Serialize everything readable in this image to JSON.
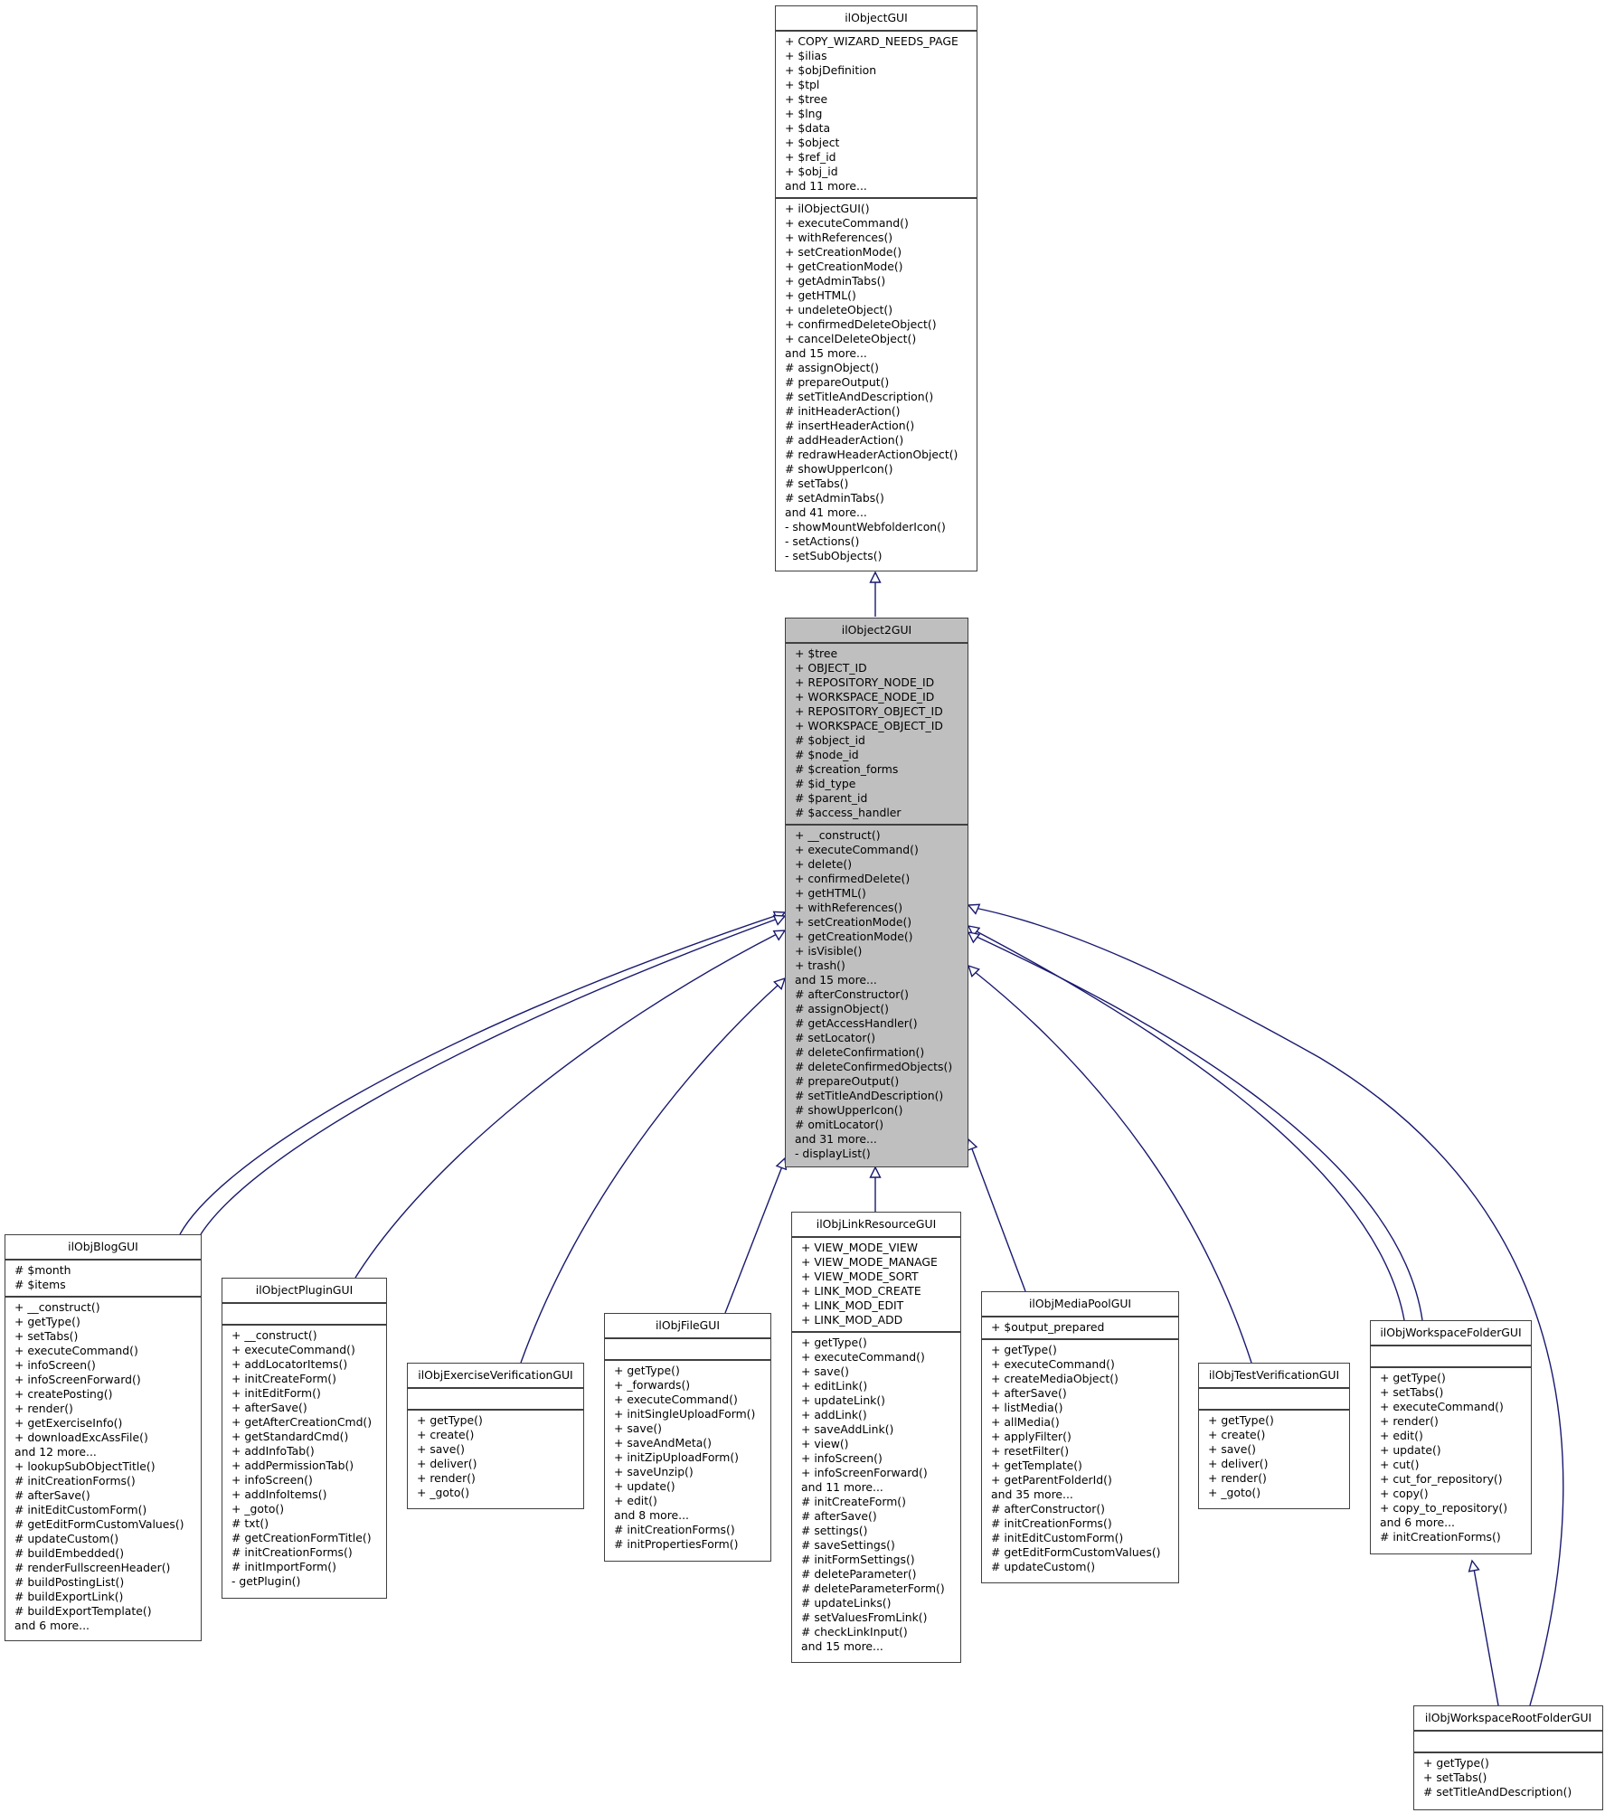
{
  "diagram": {
    "type": "uml-class-inheritance",
    "edge_color": "#191970",
    "focus_fill": "#bfbfbf"
  },
  "classes": {
    "ilObjectGUI": {
      "name": "ilObjectGUI",
      "attributes": [
        "+ COPY_WIZARD_NEEDS_PAGE",
        "+ $ilias",
        "+ $objDefinition",
        "+ $tpl",
        "+ $tree",
        "+ $lng",
        "+ $data",
        "+ $object",
        "+ $ref_id",
        "+ $obj_id",
        "and 11 more..."
      ],
      "methods": [
        "+ ilObjectGUI()",
        "+ executeCommand()",
        "+ withReferences()",
        "+ setCreationMode()",
        "+ getCreationMode()",
        "+ getAdminTabs()",
        "+ getHTML()",
        "+ undeleteObject()",
        "+ confirmedDeleteObject()",
        "+ cancelDeleteObject()",
        "and 15 more...",
        "# assignObject()",
        "# prepareOutput()",
        "# setTitleAndDescription()",
        "# initHeaderAction()",
        "# insertHeaderAction()",
        "# addHeaderAction()",
        "# redrawHeaderActionObject()",
        "# showUpperIcon()",
        "# setTabs()",
        "# setAdminTabs()",
        "and 41 more...",
        "- showMountWebfolderIcon()",
        "- setActions()",
        "- setSubObjects()"
      ]
    },
    "ilObject2GUI": {
      "name": "ilObject2GUI",
      "attributes": [
        "+ $tree",
        "+ OBJECT_ID",
        "+ REPOSITORY_NODE_ID",
        "+ WORKSPACE_NODE_ID",
        "+ REPOSITORY_OBJECT_ID",
        "+ WORKSPACE_OBJECT_ID",
        "# $object_id",
        "# $node_id",
        "# $creation_forms",
        "# $id_type",
        "# $parent_id",
        "# $access_handler"
      ],
      "methods": [
        "+ __construct()",
        "+ executeCommand()",
        "+ delete()",
        "+ confirmedDelete()",
        "+ getHTML()",
        "+ withReferences()",
        "+ setCreationMode()",
        "+ getCreationMode()",
        "+ isVisible()",
        "+ trash()",
        "and 15 more...",
        "# afterConstructor()",
        "# assignObject()",
        "# getAccessHandler()",
        "# setLocator()",
        "# deleteConfirmation()",
        "# deleteConfirmedObjects()",
        "# prepareOutput()",
        "# setTitleAndDescription()",
        "# showUpperIcon()",
        "# omitLocator()",
        "and 31 more...",
        "- displayList()"
      ]
    },
    "ilObjBlogGUI": {
      "name": "ilObjBlogGUI",
      "attributes": [
        "# $month",
        "# $items"
      ],
      "methods": [
        "+ __construct()",
        "+ getType()",
        "+ setTabs()",
        "+ executeCommand()",
        "+ infoScreen()",
        "+ infoScreenForward()",
        "+ createPosting()",
        "+ render()",
        "+ getExerciseInfo()",
        "+ downloadExcAssFile()",
        "and 12 more...",
        "+ lookupSubObjectTitle()",
        "# initCreationForms()",
        "# afterSave()",
        "# initEditCustomForm()",
        "# getEditFormCustomValues()",
        "# updateCustom()",
        "# buildEmbedded()",
        "# renderFullscreenHeader()",
        "# buildPostingList()",
        "# buildExportLink()",
        "# buildExportTemplate()",
        "and 6 more..."
      ]
    },
    "ilObjectPluginGUI": {
      "name": "ilObjectPluginGUI",
      "attributes": [],
      "methods": [
        "+ __construct()",
        "+ executeCommand()",
        "+ addLocatorItems()",
        "+ initCreateForm()",
        "+ initEditForm()",
        "+ afterSave()",
        "+ getAfterCreationCmd()",
        "+ getStandardCmd()",
        "+ addInfoTab()",
        "+ addPermissionTab()",
        "+ infoScreen()",
        "+ addInfoItems()",
        "+ _goto()",
        "# txt()",
        "# getCreationFormTitle()",
        "# initCreationForms()",
        "# initImportForm()",
        "- getPlugin()"
      ]
    },
    "ilObjExerciseVerificationGUI": {
      "name": "ilObjExerciseVerificationGUI",
      "attributes": [],
      "methods": [
        "+ getType()",
        "+ create()",
        "+ save()",
        "+ deliver()",
        "+ render()",
        "+ _goto()"
      ]
    },
    "ilObjFileGUI": {
      "name": "ilObjFileGUI",
      "attributes": [],
      "methods": [
        "+ getType()",
        "+ _forwards()",
        "+ executeCommand()",
        "+ initSingleUploadForm()",
        "+ save()",
        "+ saveAndMeta()",
        "+ initZipUploadForm()",
        "+ saveUnzip()",
        "+ update()",
        "+ edit()",
        "and 8 more...",
        "# initCreationForms()",
        "# initPropertiesForm()"
      ]
    },
    "ilObjLinkResourceGUI": {
      "name": "ilObjLinkResourceGUI",
      "attributes": [
        "+ VIEW_MODE_VIEW",
        "+ VIEW_MODE_MANAGE",
        "+ VIEW_MODE_SORT",
        "+ LINK_MOD_CREATE",
        "+ LINK_MOD_EDIT",
        "+ LINK_MOD_ADD"
      ],
      "methods": [
        "+ getType()",
        "+ executeCommand()",
        "+ save()",
        "+ editLink()",
        "+ updateLink()",
        "+ addLink()",
        "+ saveAddLink()",
        "+ view()",
        "+ infoScreen()",
        "+ infoScreenForward()",
        "and 11 more...",
        "# initCreateForm()",
        "# afterSave()",
        "# settings()",
        "# saveSettings()",
        "# initFormSettings()",
        "# deleteParameter()",
        "# deleteParameterForm()",
        "# updateLinks()",
        "# setValuesFromLink()",
        "# checkLinkInput()",
        "and 15 more..."
      ]
    },
    "ilObjMediaPoolGUI": {
      "name": "ilObjMediaPoolGUI",
      "attributes": [
        "+ $output_prepared"
      ],
      "methods": [
        "+ getType()",
        "+ executeCommand()",
        "+ createMediaObject()",
        "+ afterSave()",
        "+ listMedia()",
        "+ allMedia()",
        "+ applyFilter()",
        "+ resetFilter()",
        "+ getTemplate()",
        "+ getParentFolderId()",
        "and 35 more...",
        "# afterConstructor()",
        "# initCreationForms()",
        "# initEditCustomForm()",
        "# getEditFormCustomValues()",
        "# updateCustom()"
      ]
    },
    "ilObjTestVerificationGUI": {
      "name": "ilObjTestVerificationGUI",
      "attributes": [],
      "methods": [
        "+ getType()",
        "+ create()",
        "+ save()",
        "+ deliver()",
        "+ render()",
        "+ _goto()"
      ]
    },
    "ilObjWorkspaceFolderGUI": {
      "name": "ilObjWorkspaceFolderGUI",
      "attributes": [],
      "methods": [
        "+ getType()",
        "+ setTabs()",
        "+ executeCommand()",
        "+ render()",
        "+ edit()",
        "+ update()",
        "+ cut()",
        "+ cut_for_repository()",
        "+ copy()",
        "+ copy_to_repository()",
        "and 6 more...",
        "# initCreationForms()"
      ]
    },
    "ilObjWorkspaceRootFolderGUI": {
      "name": "ilObjWorkspaceRootFolderGUI",
      "attributes": [],
      "methods": [
        "+ getType()",
        "+ setTabs()",
        "# setTitleAndDescription()"
      ]
    }
  },
  "inheritance": [
    {
      "child": "ilObject2GUI",
      "parent": "ilObjectGUI"
    },
    {
      "child": "ilObjBlogGUI",
      "parent": "ilObject2GUI"
    },
    {
      "child": "ilObjBlogGUI",
      "parent": "ilObject2GUI"
    },
    {
      "child": "ilObjectPluginGUI",
      "parent": "ilObject2GUI"
    },
    {
      "child": "ilObjExerciseVerificationGUI",
      "parent": "ilObject2GUI"
    },
    {
      "child": "ilObjFileGUI",
      "parent": "ilObject2GUI"
    },
    {
      "child": "ilObjLinkResourceGUI",
      "parent": "ilObject2GUI"
    },
    {
      "child": "ilObjMediaPoolGUI",
      "parent": "ilObject2GUI"
    },
    {
      "child": "ilObjTestVerificationGUI",
      "parent": "ilObject2GUI"
    },
    {
      "child": "ilObjWorkspaceFolderGUI",
      "parent": "ilObject2GUI"
    },
    {
      "child": "ilObjWorkspaceFolderGUI",
      "parent": "ilObject2GUI"
    },
    {
      "child": "ilObjWorkspaceRootFolderGUI",
      "parent": "ilObject2GUI"
    },
    {
      "child": "ilObjWorkspaceRootFolderGUI",
      "parent": "ilObjWorkspaceFolderGUI"
    }
  ]
}
